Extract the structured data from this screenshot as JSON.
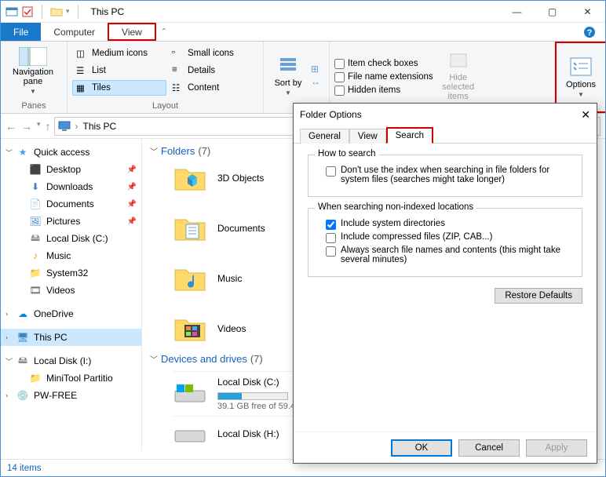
{
  "titlebar": {
    "title": "This PC"
  },
  "tabs": {
    "file": "File",
    "computer": "Computer",
    "view": "View"
  },
  "ribbon": {
    "navpane": "Navigation pane",
    "panes_label": "Panes",
    "layout_label": "Layout",
    "layout": {
      "medium": "Medium icons",
      "small": "Small icons",
      "list": "List",
      "details": "Details",
      "tiles": "Tiles",
      "content": "Content"
    },
    "sort": "Sort by",
    "sh": {
      "itemcheck": "Item check boxes",
      "fne": "File name extensions",
      "hidden": "Hidden items",
      "hide": "Hide selected items"
    },
    "options": "Options"
  },
  "addr": {
    "thispc": "This PC"
  },
  "sidebar": {
    "quick": "Quick access",
    "desktop": "Desktop",
    "downloads": "Downloads",
    "documents": "Documents",
    "pictures": "Pictures",
    "localc": "Local Disk (C:)",
    "music": "Music",
    "system32": "System32",
    "videos": "Videos",
    "onedrive": "OneDrive",
    "thispc": "This PC",
    "locali": "Local Disk (I:)",
    "minitool": "MiniTool Partitio",
    "pwfree": "PW-FREE"
  },
  "content": {
    "folders_hdr": "Folders",
    "folders_count": "(7)",
    "folders": {
      "obj3d": "3D Objects",
      "documents": "Documents",
      "music": "Music",
      "videos": "Videos"
    },
    "drives_hdr": "Devices and drives",
    "drives_count": "(7)",
    "drivec": "Local Disk (C:)",
    "drivec_sub": "39.1 GB free of 59.4",
    "driveh": "Local Disk (H:)"
  },
  "status": {
    "items": "14 items"
  },
  "modal": {
    "title": "Folder Options",
    "tabs": {
      "general": "General",
      "view": "View",
      "search": "Search"
    },
    "how_legend": "How to search",
    "how_dont_index": "Don't use the index when searching in file folders for system files (searches might take longer)",
    "nonidx_legend": "When searching non-indexed locations",
    "include_sys": "Include system directories",
    "include_zip": "Include compressed files (ZIP, CAB...)",
    "always_search": "Always search file names and contents (this might take several minutes)",
    "restore": "Restore Defaults",
    "ok": "OK",
    "cancel": "Cancel",
    "apply": "Apply"
  }
}
